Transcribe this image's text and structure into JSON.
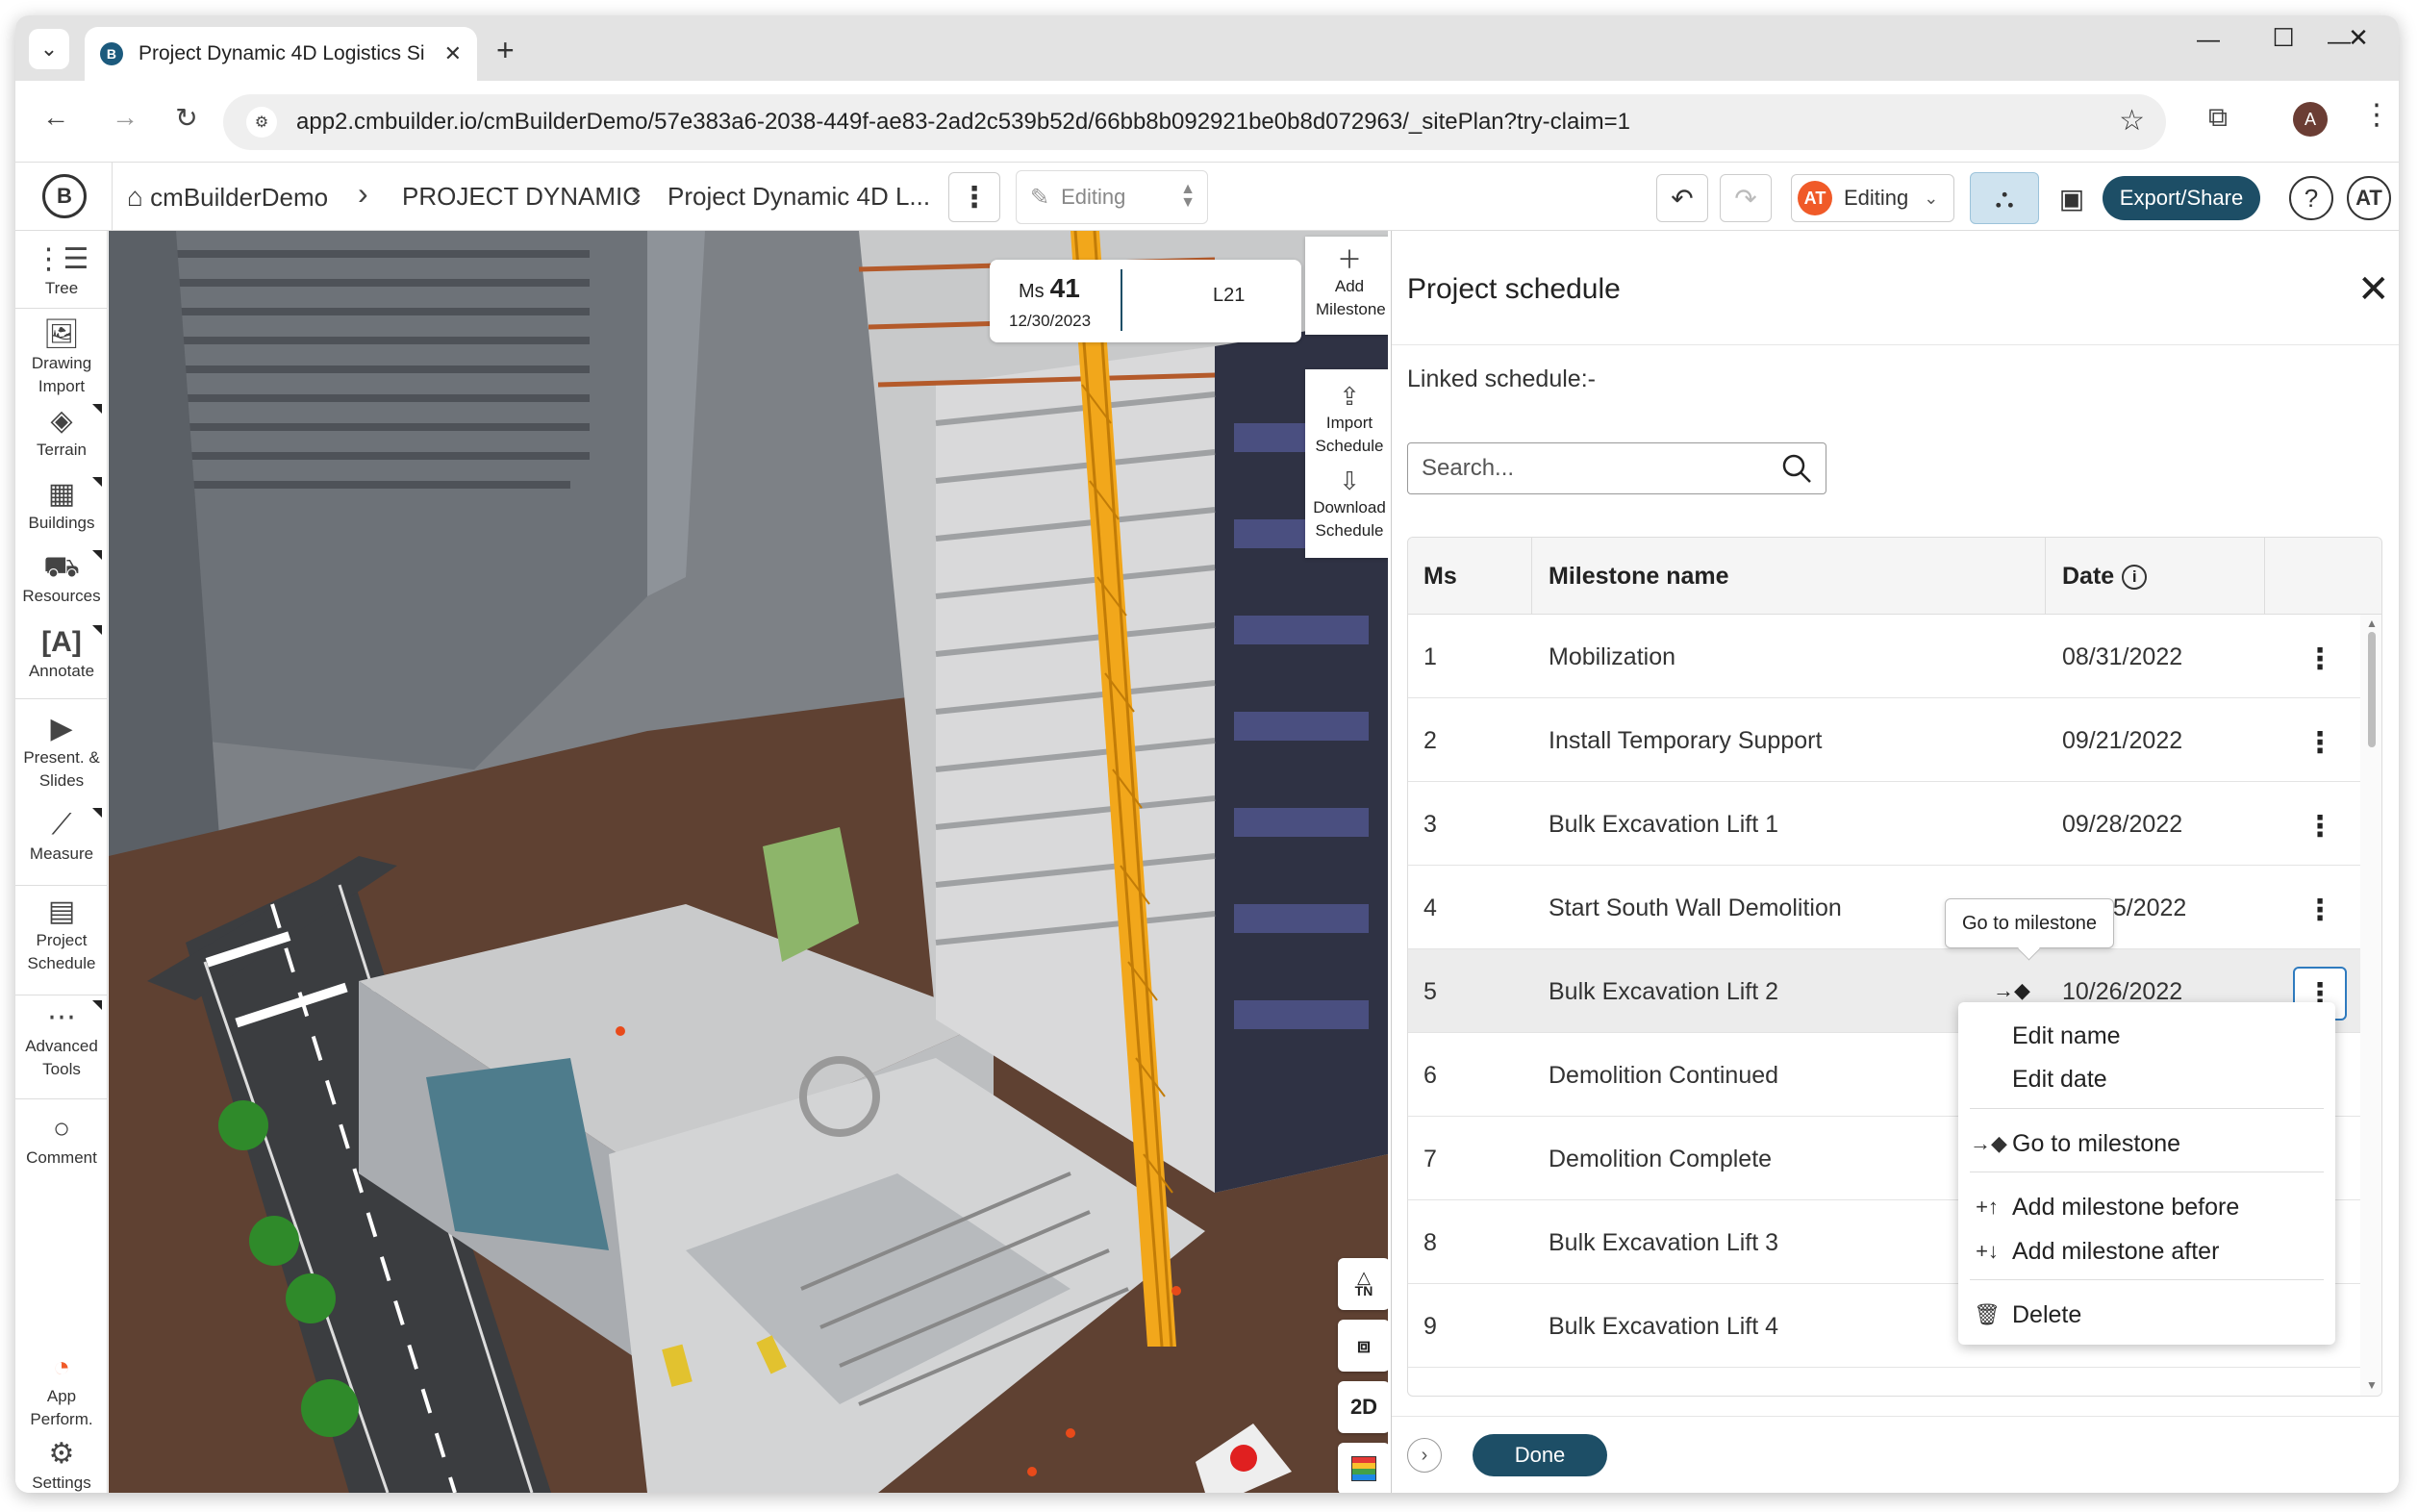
{
  "browser": {
    "tab_title": "Project Dynamic 4D Logistics Si",
    "tab_favicon": "B",
    "url": "app2.cmbuilder.io/cmBuilderDemo/57e383a6-2038-449f-ae83-2ad2c539b52d/66bb8b092921be0b8d072963/_sitePlan?try-claim=1",
    "profile_initial": "A"
  },
  "header": {
    "logo": "B",
    "breadcrumb": [
      "cmBuilderDemo",
      "PROJECT DYNAMIC",
      "Project Dynamic 4D L..."
    ],
    "mode_select": "Editing",
    "user_badge": "AT",
    "editing_label": "Editing",
    "export_label": "Export/Share",
    "help": "?",
    "avatar": "AT"
  },
  "sidebar": {
    "items": [
      {
        "label": "Tree",
        "icon": "tree-icon"
      },
      {
        "label": "Drawing Import",
        "icon": "drawing-import-icon"
      },
      {
        "label": "Terrain",
        "icon": "terrain-icon"
      },
      {
        "label": "Buildings",
        "icon": "buildings-icon"
      },
      {
        "label": "Resources",
        "icon": "resources-icon"
      },
      {
        "label": "Annotate",
        "icon": "annotate-icon"
      },
      {
        "label": "Present. & Slides",
        "icon": "slides-icon"
      },
      {
        "label": "Measure",
        "icon": "measure-icon"
      },
      {
        "label": "Project Schedule",
        "icon": "schedule-icon"
      },
      {
        "label": "Advanced Tools",
        "icon": "advanced-tools-icon"
      },
      {
        "label": "Comment",
        "icon": "comment-icon"
      },
      {
        "label": "App Perform.",
        "icon": "performance-icon"
      },
      {
        "label": "Settings",
        "icon": "gear-icon"
      }
    ]
  },
  "viewport": {
    "ms_prefix": "Ms",
    "ms_number": "41",
    "ms_date": "12/30/2023",
    "level": "L21",
    "add_milestone": "Add Milestone",
    "import_schedule": "Import Schedule",
    "download_schedule": "Download Schedule",
    "north_label": "TN",
    "view_2d": "2D"
  },
  "panel": {
    "title": "Project schedule",
    "linked_schedule": "Linked schedule:-",
    "search_placeholder": "Search...",
    "columns": {
      "ms": "Ms",
      "name": "Milestone name",
      "date": "Date"
    },
    "rows": [
      {
        "ms": "1",
        "name": "Mobilization",
        "date": "08/31/2022"
      },
      {
        "ms": "2",
        "name": "Install Temporary Support",
        "date": "09/21/2022"
      },
      {
        "ms": "3",
        "name": "Bulk Excavation Lift 1",
        "date": "09/28/2022"
      },
      {
        "ms": "4",
        "name": "Start South Wall Demolition",
        "date": "/05/2022"
      },
      {
        "ms": "5",
        "name": "Bulk Excavation Lift 2",
        "date": "10/26/2022"
      },
      {
        "ms": "6",
        "name": "Demolition Continued",
        "date": ""
      },
      {
        "ms": "7",
        "name": "Demolition Complete",
        "date": ""
      },
      {
        "ms": "8",
        "name": "Bulk Excavation Lift 3",
        "date": ""
      },
      {
        "ms": "9",
        "name": "Bulk Excavation Lift 4",
        "date": ""
      }
    ],
    "tooltip": "Go to milestone",
    "context_menu": {
      "edit_name": "Edit name",
      "edit_date": "Edit date",
      "go_to": "Go to milestone",
      "add_before": "Add milestone before",
      "add_after": "Add milestone after",
      "delete": "Delete"
    },
    "done_label": "Done"
  },
  "colors": {
    "accent": "#1d4e66",
    "badge": "#f05a28",
    "crane": "#f2a71b"
  }
}
